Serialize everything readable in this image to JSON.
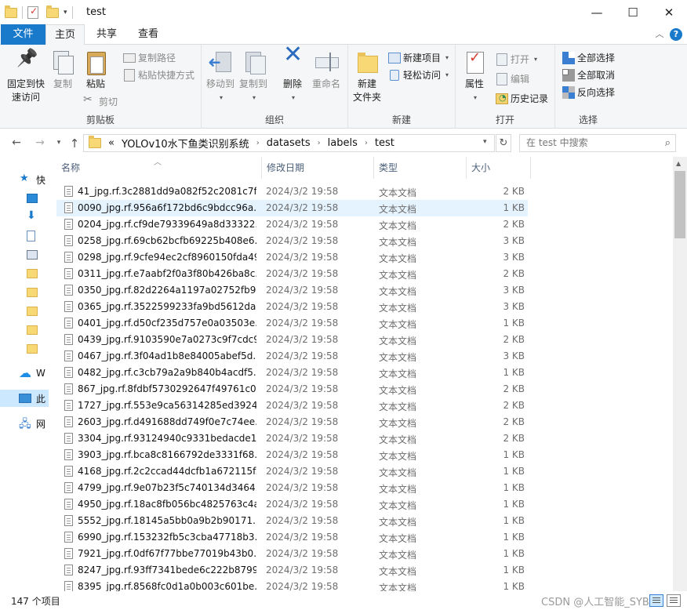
{
  "window": {
    "title": "test"
  },
  "tabs": {
    "file": "文件",
    "home": "主页",
    "share": "共享",
    "view": "查看"
  },
  "ribbon": {
    "clipboard": {
      "label": "剪贴板",
      "pin": "固定到快\n速访问",
      "pin_l1": "固定到快",
      "pin_l2": "速访问",
      "copy": "复制",
      "paste": "粘贴",
      "copy_path": "复制路径",
      "paste_shortcut": "粘贴快捷方式",
      "cut": "剪切"
    },
    "organize": {
      "label": "组织",
      "move_to": "移动到",
      "copy_to": "复制到",
      "delete": "删除",
      "rename": "重命名"
    },
    "new": {
      "label": "新建",
      "new_folder_l1": "新建",
      "new_folder_l2": "文件夹",
      "new_item": "新建项目",
      "easy_access": "轻松访问"
    },
    "open": {
      "label": "打开",
      "properties": "属性",
      "open": "打开",
      "edit": "编辑",
      "history": "历史记录"
    },
    "select": {
      "label": "选择",
      "select_all": "全部选择",
      "select_none": "全部取消",
      "invert": "反向选择"
    }
  },
  "address": {
    "overflow": "«",
    "crumbs": [
      "YOLOv10水下鱼类识别系统",
      "datasets",
      "labels",
      "test"
    ],
    "search_placeholder": "在 test 中搜索"
  },
  "nav": {
    "quick_access": "快",
    "items": [
      "",
      "",
      "",
      "",
      "",
      "",
      "",
      "",
      ""
    ],
    "onedrive": "W",
    "this_pc": "此",
    "network": "网"
  },
  "columns": {
    "name": "名称",
    "date": "修改日期",
    "type": "类型",
    "size": "大小"
  },
  "files": [
    {
      "name": "41_jpg.rf.3c2881dd9a082f52c2081c7f...",
      "date": "2024/3/2 19:58",
      "type": "文本文档",
      "size": "2 KB"
    },
    {
      "name": "0090_jpg.rf.956a6f172bd6c9bdcc96a...",
      "date": "2024/3/2 19:58",
      "type": "文本文档",
      "size": "1 KB"
    },
    {
      "name": "0204_jpg.rf.cf9de79339649a8d33322...",
      "date": "2024/3/2 19:58",
      "type": "文本文档",
      "size": "2 KB"
    },
    {
      "name": "0258_jpg.rf.69cb62bcfb69225b408e6...",
      "date": "2024/3/2 19:58",
      "type": "文本文档",
      "size": "3 KB"
    },
    {
      "name": "0298_jpg.rf.9cfe94ec2cf8960150fda49...",
      "date": "2024/3/2 19:58",
      "type": "文本文档",
      "size": "3 KB"
    },
    {
      "name": "0311_jpg.rf.e7aabf2f0a3f80b426ba8c...",
      "date": "2024/3/2 19:58",
      "type": "文本文档",
      "size": "2 KB"
    },
    {
      "name": "0350_jpg.rf.82d2264a1197a02752fb9...",
      "date": "2024/3/2 19:58",
      "type": "文本文档",
      "size": "3 KB"
    },
    {
      "name": "0365_jpg.rf.3522599233fa9bd5612da...",
      "date": "2024/3/2 19:58",
      "type": "文本文档",
      "size": "3 KB"
    },
    {
      "name": "0401_jpg.rf.d50cf235d757e0a03503e...",
      "date": "2024/3/2 19:58",
      "type": "文本文档",
      "size": "1 KB"
    },
    {
      "name": "0439_jpg.rf.9103590e7a0273c9f7cdc9...",
      "date": "2024/3/2 19:58",
      "type": "文本文档",
      "size": "2 KB"
    },
    {
      "name": "0467_jpg.rf.3f04ad1b8e84005abef5d...",
      "date": "2024/3/2 19:58",
      "type": "文本文档",
      "size": "3 KB"
    },
    {
      "name": "0482_jpg.rf.c3cb79a2a9b840b4acdf5...",
      "date": "2024/3/2 19:58",
      "type": "文本文档",
      "size": "1 KB"
    },
    {
      "name": "867_jpg.rf.8fdbf5730292647f49761c0...",
      "date": "2024/3/2 19:58",
      "type": "文本文档",
      "size": "2 KB"
    },
    {
      "name": "1727_jpg.rf.553e9ca56314285ed3924...",
      "date": "2024/3/2 19:58",
      "type": "文本文档",
      "size": "2 KB"
    },
    {
      "name": "2603_jpg.rf.d491688dd749f0e7c74ee...",
      "date": "2024/3/2 19:58",
      "type": "文本文档",
      "size": "2 KB"
    },
    {
      "name": "3304_jpg.rf.93124940c9331bedacde1...",
      "date": "2024/3/2 19:58",
      "type": "文本文档",
      "size": "2 KB"
    },
    {
      "name": "3903_jpg.rf.bca8c8166792de3331f68...",
      "date": "2024/3/2 19:58",
      "type": "文本文档",
      "size": "1 KB"
    },
    {
      "name": "4168_jpg.rf.2c2ccad44dcfb1a672115f...",
      "date": "2024/3/2 19:58",
      "type": "文本文档",
      "size": "1 KB"
    },
    {
      "name": "4799_jpg.rf.9e07b23f5c740134d3464...",
      "date": "2024/3/2 19:58",
      "type": "文本文档",
      "size": "1 KB"
    },
    {
      "name": "4950_jpg.rf.18ac8fb056bc4825763c4a...",
      "date": "2024/3/2 19:58",
      "type": "文本文档",
      "size": "1 KB"
    },
    {
      "name": "5552_jpg.rf.18145a5bb0a9b2b90171...",
      "date": "2024/3/2 19:58",
      "type": "文本文档",
      "size": "1 KB"
    },
    {
      "name": "6990_jpg.rf.153232fb5c3cba47718b3...",
      "date": "2024/3/2 19:58",
      "type": "文本文档",
      "size": "1 KB"
    },
    {
      "name": "7921_jpg.rf.0df67f77bbe77019b43b0...",
      "date": "2024/3/2 19:58",
      "type": "文本文档",
      "size": "1 KB"
    },
    {
      "name": "8247_jpg.rf.93ff7341bede6c222b8799...",
      "date": "2024/3/2 19:58",
      "type": "文本文档",
      "size": "1 KB"
    },
    {
      "name": "8395_jpg.rf.8568fc0d1a0b003c601be...",
      "date": "2024/3/2 19:58",
      "type": "文本文档",
      "size": "1 KB"
    }
  ],
  "hover_row_index": 1,
  "status": {
    "count": "147 个项目",
    "watermark": "CSDN @人工智能_SYBH"
  },
  "colors": {
    "accent": "#1979ca",
    "hover": "#e5f3ff",
    "selected": "#cce8ff"
  }
}
